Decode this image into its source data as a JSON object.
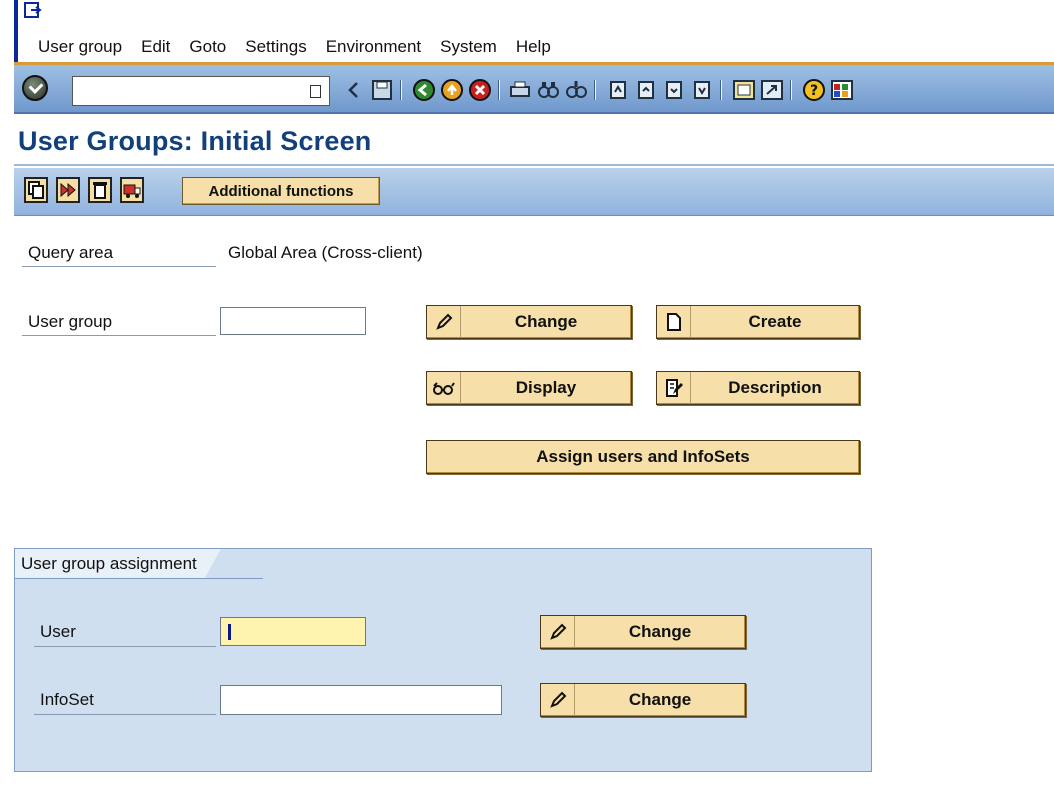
{
  "menu": {
    "items": [
      {
        "label": "User group"
      },
      {
        "label": "Edit"
      },
      {
        "label": "Goto"
      },
      {
        "label": "Settings"
      },
      {
        "label": "Environment"
      },
      {
        "label": "System"
      },
      {
        "label": "Help"
      }
    ]
  },
  "toolbar": {
    "command_field_value": ""
  },
  "title": "User Groups: Initial Screen",
  "app_toolbar": {
    "additional_functions_label": "Additional functions"
  },
  "form": {
    "query_area_label": "Query area",
    "query_area_value": "Global Area (Cross-client)",
    "user_group_label": "User group",
    "user_group_value": "",
    "change_label": "Change",
    "create_label": "Create",
    "display_label": "Display",
    "description_label": "Description",
    "assign_label": "Assign users and InfoSets"
  },
  "assignment": {
    "title": "User group assignment",
    "user_label": "User",
    "user_value": "",
    "infoset_label": "InfoSet",
    "infoset_value": "",
    "change_user_label": "Change",
    "change_infoset_label": "Change"
  },
  "colors": {
    "title_blue": "#12407a",
    "button_fill": "#f6dfa8",
    "group_fill": "#cfdff0",
    "required_field": "#fff3b0"
  }
}
